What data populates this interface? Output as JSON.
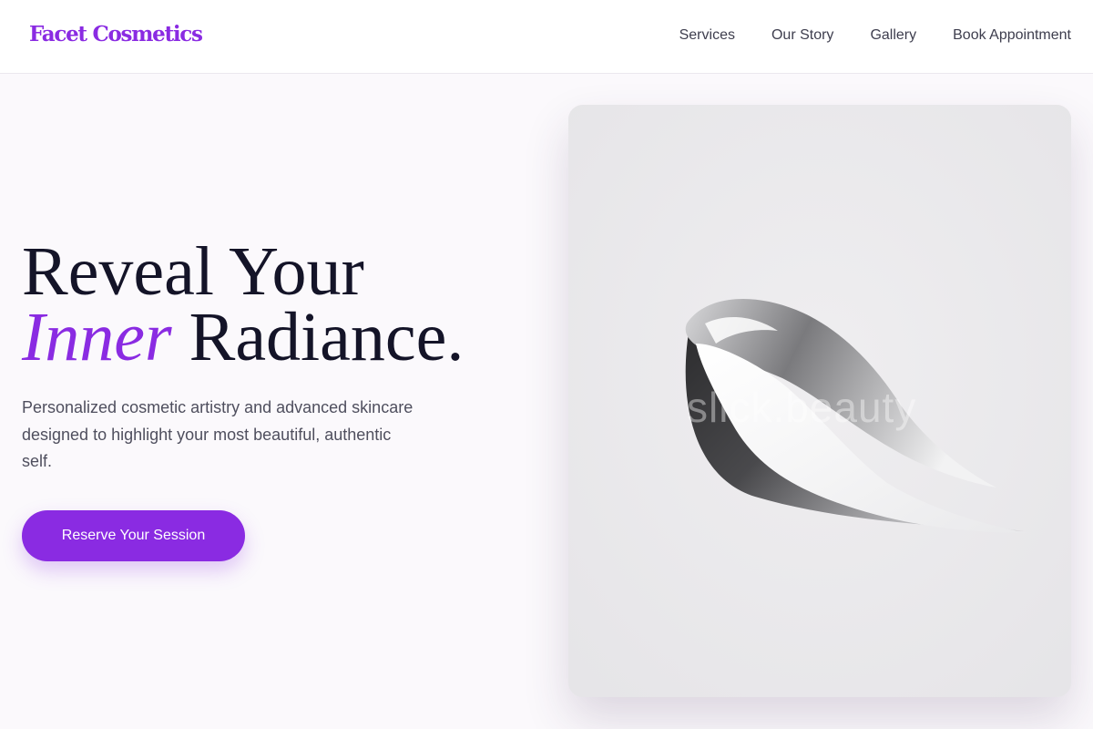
{
  "header": {
    "logo": "Facet Cosmetics",
    "nav": [
      "Services",
      "Our Story",
      "Gallery",
      "Book Appointment"
    ]
  },
  "hero": {
    "title_line1": "Reveal Your",
    "title_accent": "Inner",
    "title_rest": "Radiance.",
    "subtitle": "Personalized cosmetic artistry and advanced skincare designed to highlight your most beautiful, authentic self.",
    "cta_label": "Reserve Your Session",
    "image_watermark": "slick.beauty"
  },
  "colors": {
    "accent": "#8a2be2",
    "heading": "#141428",
    "body_text": "#4f4f5e",
    "background": "#fbf9fc",
    "image_bg": "#ebeaec"
  }
}
